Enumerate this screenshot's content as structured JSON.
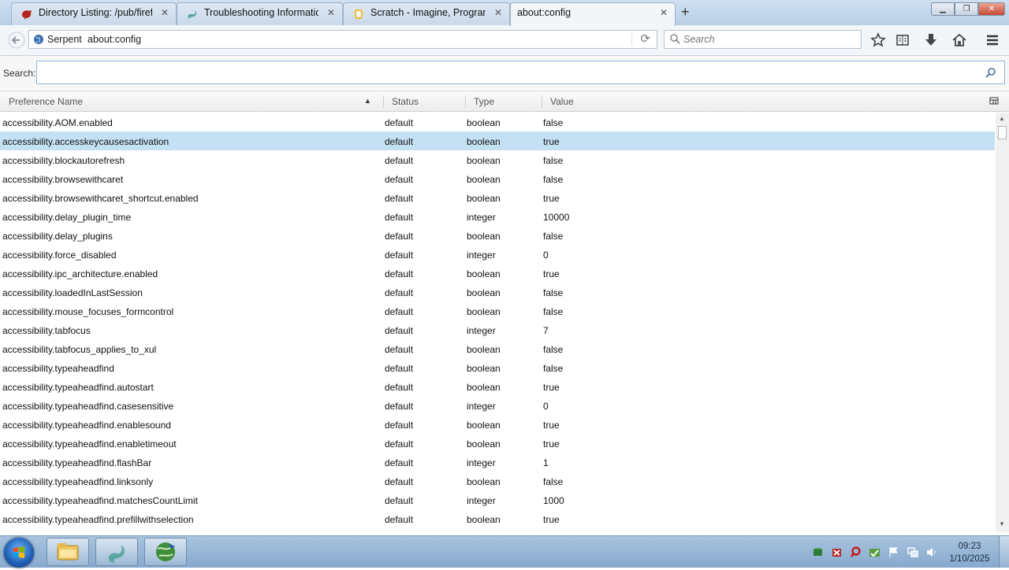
{
  "tabs": [
    {
      "title": "Directory Listing: /pub/firefo",
      "icon": "mozilla-dino-icon"
    },
    {
      "title": "Troubleshooting Informatio",
      "icon": "serpent-icon"
    },
    {
      "title": "Scratch - Imagine, Program,",
      "icon": "scratch-icon"
    },
    {
      "title": "about:config",
      "icon": "none"
    }
  ],
  "new_tab": "+",
  "window_controls": {
    "minimize": "▁",
    "maximize": "❐",
    "close": "✕"
  },
  "nav": {
    "identity_label": "Serpent",
    "url": "about:config",
    "search_placeholder": "Search",
    "icons": [
      "star-icon",
      "reading-list-icon",
      "download-icon",
      "home-icon",
      "menu-icon"
    ]
  },
  "config": {
    "search_label": "Search:",
    "search_value": "",
    "columns": {
      "name": "Preference Name",
      "status": "Status",
      "type": "Type",
      "value": "Value"
    },
    "sort_indicator": "▲",
    "rows": [
      {
        "name": "accessibility.AOM.enabled",
        "status": "default",
        "type": "boolean",
        "value": "false"
      },
      {
        "name": "accessibility.accesskeycausesactivation",
        "status": "default",
        "type": "boolean",
        "value": "true",
        "selected": true
      },
      {
        "name": "accessibility.blockautorefresh",
        "status": "default",
        "type": "boolean",
        "value": "false"
      },
      {
        "name": "accessibility.browsewithcaret",
        "status": "default",
        "type": "boolean",
        "value": "false"
      },
      {
        "name": "accessibility.browsewithcaret_shortcut.enabled",
        "status": "default",
        "type": "boolean",
        "value": "true"
      },
      {
        "name": "accessibility.delay_plugin_time",
        "status": "default",
        "type": "integer",
        "value": "10000"
      },
      {
        "name": "accessibility.delay_plugins",
        "status": "default",
        "type": "boolean",
        "value": "false"
      },
      {
        "name": "accessibility.force_disabled",
        "status": "default",
        "type": "integer",
        "value": "0"
      },
      {
        "name": "accessibility.ipc_architecture.enabled",
        "status": "default",
        "type": "boolean",
        "value": "true"
      },
      {
        "name": "accessibility.loadedInLastSession",
        "status": "default",
        "type": "boolean",
        "value": "false"
      },
      {
        "name": "accessibility.mouse_focuses_formcontrol",
        "status": "default",
        "type": "boolean",
        "value": "false"
      },
      {
        "name": "accessibility.tabfocus",
        "status": "default",
        "type": "integer",
        "value": "7"
      },
      {
        "name": "accessibility.tabfocus_applies_to_xul",
        "status": "default",
        "type": "boolean",
        "value": "false"
      },
      {
        "name": "accessibility.typeaheadfind",
        "status": "default",
        "type": "boolean",
        "value": "false"
      },
      {
        "name": "accessibility.typeaheadfind.autostart",
        "status": "default",
        "type": "boolean",
        "value": "true"
      },
      {
        "name": "accessibility.typeaheadfind.casesensitive",
        "status": "default",
        "type": "integer",
        "value": "0"
      },
      {
        "name": "accessibility.typeaheadfind.enablesound",
        "status": "default",
        "type": "boolean",
        "value": "true"
      },
      {
        "name": "accessibility.typeaheadfind.enabletimeout",
        "status": "default",
        "type": "boolean",
        "value": "true"
      },
      {
        "name": "accessibility.typeaheadfind.flashBar",
        "status": "default",
        "type": "integer",
        "value": "1"
      },
      {
        "name": "accessibility.typeaheadfind.linksonly",
        "status": "default",
        "type": "boolean",
        "value": "false"
      },
      {
        "name": "accessibility.typeaheadfind.matchesCountLimit",
        "status": "default",
        "type": "integer",
        "value": "1000"
      },
      {
        "name": "accessibility.typeaheadfind.prefillwithselection",
        "status": "default",
        "type": "boolean",
        "value": "true"
      }
    ]
  },
  "taskbar": {
    "pinned": [
      "explorer-icon",
      "serpent-icon",
      "network-globe-icon"
    ],
    "tray": [
      "app-tray-icon-1",
      "app-tray-icon-2",
      "app-tray-icon-3",
      "app-tray-icon-4",
      "action-center-flag-icon",
      "network-icon",
      "volume-icon"
    ],
    "time": "09:23",
    "date": "1/10/2025"
  },
  "colors": {
    "selected_row": "#c4e1f3",
    "search_border": "#8fb7d8",
    "taskbar": "#9dbbd9"
  }
}
